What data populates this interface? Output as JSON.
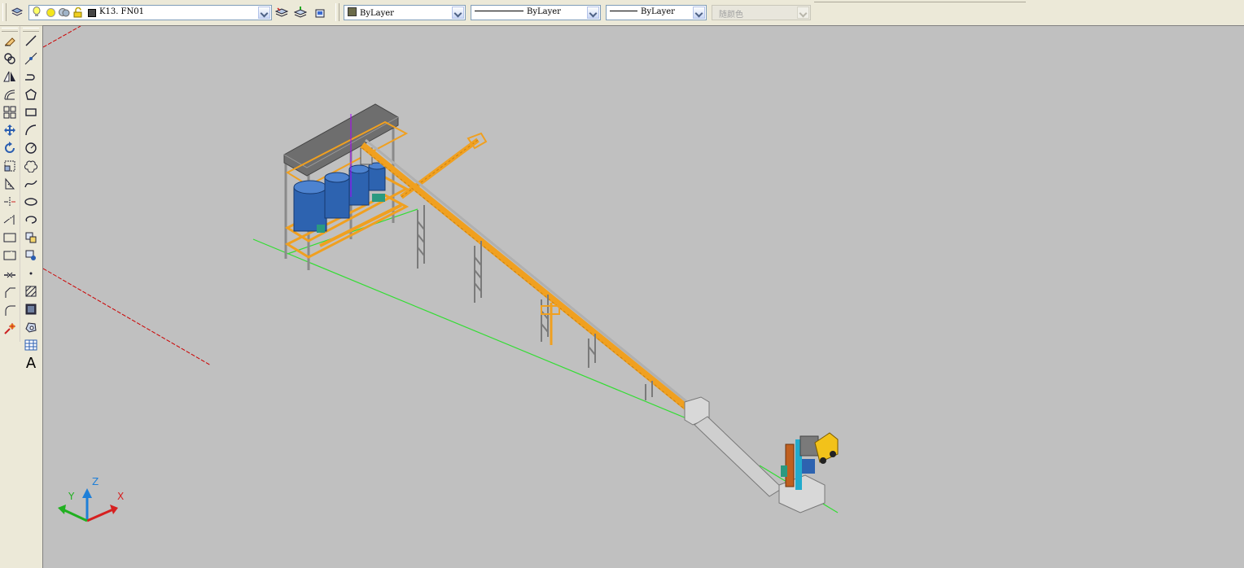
{
  "toolbar": {
    "layer": {
      "value": "K13. FN01",
      "layer_icons": [
        "bulb-icon",
        "sun-icon",
        "globe-icon",
        "lock-icon"
      ]
    },
    "color": {
      "value": "ByLayer"
    },
    "linetype": {
      "value": "ByLayer"
    },
    "lineweight": {
      "value": "ByLayer"
    },
    "plotstyle": {
      "value": "随颜色"
    }
  },
  "modify_tools": [
    "erase-icon",
    "copy-icon",
    "mirror-icon",
    "offset-icon",
    "array-icon",
    "move-icon",
    "rotate-icon",
    "scale-icon",
    "stretch-icon",
    "trim-icon",
    "extend-icon",
    "break-icon",
    "break-at-point-icon",
    "join-icon",
    "chamfer-icon",
    "fillet-icon",
    "explode-icon"
  ],
  "draw_tools": [
    "line-icon",
    "construction-line-icon",
    "polyline-icon",
    "polygon-icon",
    "rectangle-icon",
    "arc-icon",
    "circle-icon",
    "revision-cloud-icon",
    "spline-icon",
    "ellipse-icon",
    "ellipse-arc-icon",
    "insert-block-icon",
    "make-block-icon",
    "point-icon",
    "hatch-icon",
    "gradient-icon",
    "region-icon",
    "table-icon",
    "mtext-icon"
  ],
  "draw_text_tool_label": "A",
  "ucs": {
    "x_label": "X",
    "y_label": "Y",
    "z_label": "Z"
  },
  "colors": {
    "viewport_bg": "#c0c0c0",
    "conveyor": "#f0a020",
    "silo": "#2d63b0",
    "roof": "#6e6e6e",
    "ground_line": "#33dd33",
    "crosshair": "#cc0000"
  }
}
